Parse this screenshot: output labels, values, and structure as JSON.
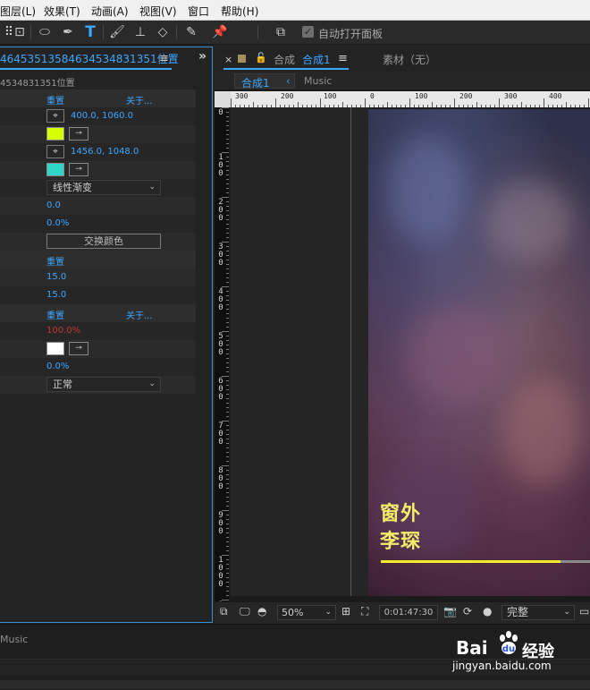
{
  "menu": {
    "items": [
      "图层(L)",
      "效果(T)",
      "动画(A)",
      "视图(V)",
      "窗口",
      "帮助(H)"
    ]
  },
  "toolbar": {
    "tools": [
      "selection-mask-icon",
      "ellipse-tool-icon",
      "pen-tool-icon",
      "type-tool-icon",
      "brush-tool-icon",
      "clone-stamp-icon",
      "eraser-icon",
      "roto-brush-icon",
      "puppet-pin-icon",
      "snap-icon"
    ],
    "auto_open_label": "自动打开面板",
    "auto_open_checked": true,
    "type_glyph": "T"
  },
  "effects_panel": {
    "tab_title": "46453513584634534831351位置",
    "menu_glyph": "≡",
    "more_glyph": "»",
    "layer_label": "4534831351位置",
    "rows": [
      {
        "kind": "header",
        "reset": "重置",
        "about": "关于..."
      },
      {
        "kind": "point",
        "value": "400.0, 1060.0"
      },
      {
        "kind": "color",
        "color": "#d6ff00"
      },
      {
        "kind": "point",
        "value": "1456.0, 1048.0"
      },
      {
        "kind": "color",
        "color": "#2fd6c8"
      },
      {
        "kind": "dropdown",
        "value": "线性渐变"
      },
      {
        "kind": "number",
        "value": "0.0"
      },
      {
        "kind": "number",
        "value": "0.0%"
      },
      {
        "kind": "button",
        "value": "交换颜色"
      },
      {
        "kind": "header",
        "reset": "重置",
        "about": ""
      },
      {
        "kind": "number",
        "value": "15.0"
      },
      {
        "kind": "number",
        "value": "15.0"
      },
      {
        "kind": "header",
        "reset": "重置",
        "about": "关于..."
      },
      {
        "kind": "number-red",
        "value": "100.0%"
      },
      {
        "kind": "color",
        "color": "#ffffff"
      },
      {
        "kind": "number",
        "value": "0.0%"
      },
      {
        "kind": "dropdown",
        "value": "正常"
      }
    ]
  },
  "composition": {
    "tab_prefix": "合成",
    "tab_name": "合成1",
    "footage_label": "素材（无）",
    "breadcrumb_active": "合成1",
    "breadcrumb_next": "Music",
    "ruler_labels": [
      "300",
      "200",
      "100",
      "0",
      "100",
      "200",
      "300",
      "400"
    ],
    "vruler_labels": [
      "0",
      "1\n0\n0",
      "2\n0\n0",
      "3\n0\n0",
      "4\n0\n0",
      "5\n0\n0",
      "6\n0\n0",
      "7\n0\n0",
      "8\n0\n0",
      "9\n0\n0",
      "1\n0\n0\n0",
      "1\n1\n0\n0",
      "1\n2\n0\n0"
    ],
    "song_title": "窗外",
    "song_artist": "李琛",
    "progress_fraction": 0.86,
    "progress_color": "#f3ec2a",
    "text_color": "#f3ec6a"
  },
  "viewer_controls": {
    "zoom": "50%",
    "timecode": "0:01:47:30",
    "quality": "完整"
  },
  "bottom": {
    "music_label": "Music"
  },
  "watermark": {
    "brand": "Bai",
    "product": "经验",
    "url": "jingyan.baidu.com"
  }
}
